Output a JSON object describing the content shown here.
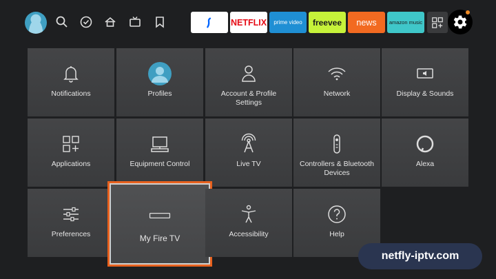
{
  "nav": {
    "icons": [
      "avatar",
      "search-icon",
      "check-circle-icon",
      "home-icon",
      "live-tv-icon",
      "bookmark-icon"
    ]
  },
  "apps": [
    {
      "id": "paramount",
      "label": "",
      "bg": "#ffffff",
      "fg": "#0064ff"
    },
    {
      "id": "netflix",
      "label": "NETFLIX",
      "bg": "#ffffff",
      "fg": "#e50914"
    },
    {
      "id": "prime-video",
      "label": "prime video",
      "bg": "#1f8fd4",
      "fg": "#ffffff"
    },
    {
      "id": "freevee",
      "label": "freevee",
      "bg": "#c6f23a",
      "fg": "#1a1a1a"
    },
    {
      "id": "news",
      "label": "news",
      "bg": "#f26a21",
      "fg": "#ffffff"
    },
    {
      "id": "amazon-music",
      "label": "amazon music",
      "bg": "#3fc7c9",
      "fg": "#1a1a1a"
    }
  ],
  "settings": [
    {
      "key": "notifications",
      "label": "Notifications",
      "icon": "bell-icon"
    },
    {
      "key": "profiles",
      "label": "Profiles",
      "icon": "profile-avatar-icon"
    },
    {
      "key": "account",
      "label": "Account & Profile Settings",
      "icon": "person-icon"
    },
    {
      "key": "network",
      "label": "Network",
      "icon": "wifi-icon"
    },
    {
      "key": "display",
      "label": "Display & Sounds",
      "icon": "display-sound-icon"
    },
    {
      "key": "applications",
      "label": "Applications",
      "icon": "apps-grid-icon"
    },
    {
      "key": "equipment",
      "label": "Equipment Control",
      "icon": "monitor-icon"
    },
    {
      "key": "livetv",
      "label": "Live TV",
      "icon": "antenna-icon"
    },
    {
      "key": "controllers",
      "label": "Controllers & Bluetooth Devices",
      "icon": "remote-icon"
    },
    {
      "key": "alexa",
      "label": "Alexa",
      "icon": "alexa-icon"
    },
    {
      "key": "preferences",
      "label": "Preferences",
      "icon": "sliders-icon"
    },
    {
      "key": "myfiretv",
      "label": "My Fire TV",
      "icon": "fire-tv-stick-icon"
    },
    {
      "key": "accessibility",
      "label": "Accessibility",
      "icon": "accessibility-icon"
    },
    {
      "key": "help",
      "label": "Help",
      "icon": "help-icon"
    }
  ],
  "focused": "myfiretv",
  "watermark": "netfly-iptv.com",
  "colors": {
    "focus_ring": "#e8611e",
    "gear_dot": "#f08a24"
  }
}
